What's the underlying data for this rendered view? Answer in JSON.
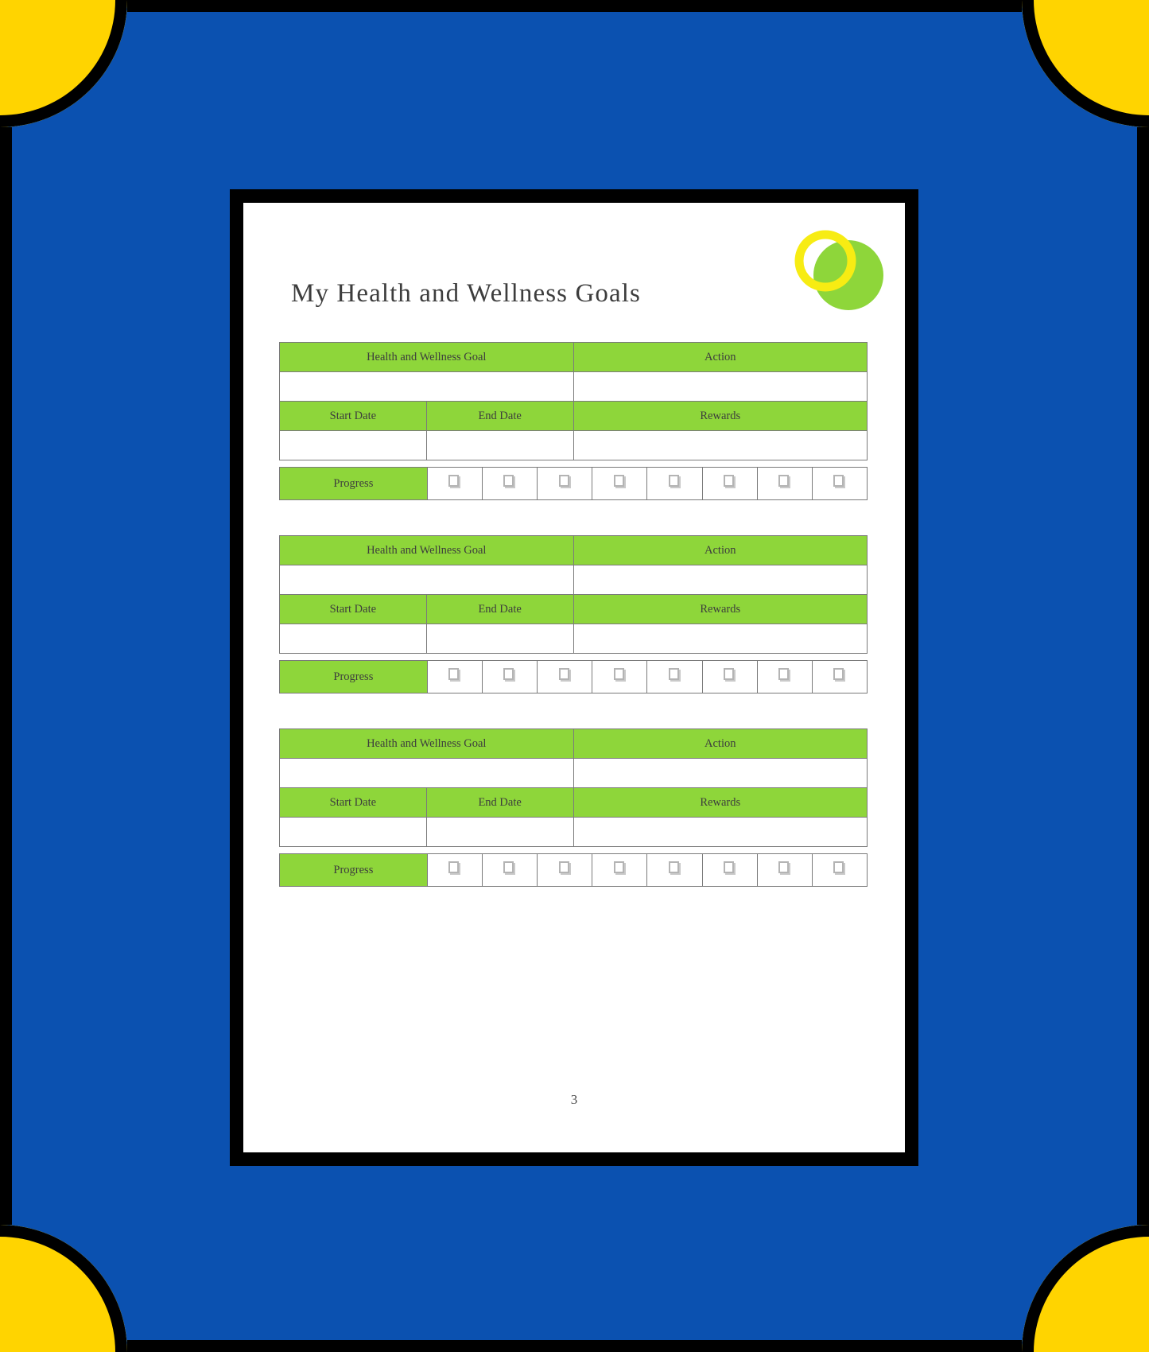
{
  "theme": {
    "background_blue": "#0b51b0",
    "corner_yellow": "#ffd400",
    "frame_black": "#000000",
    "table_green": "#8ed63a",
    "text_gray": "#3d3d3d",
    "logo_ring_yellow": "#f7ec13",
    "logo_circle_green": "#8ed63a"
  },
  "document": {
    "title": "My Health and Wellness Goals",
    "page_number": "3"
  },
  "logo": {
    "ring_name": "yellow-ring",
    "circle_name": "green-circle"
  },
  "table_headers": {
    "goal": "Health and Wellness Goal",
    "action": "Action",
    "start_date": "Start Date",
    "end_date": "End Date",
    "rewards": "Rewards",
    "progress": "Progress"
  },
  "goal_blocks": [
    {
      "index": 1,
      "goal_value": "",
      "action_value": "",
      "start_date_value": "",
      "end_date_value": "",
      "rewards_value": "",
      "progress_checkboxes": [
        {
          "checked": false
        },
        {
          "checked": false
        },
        {
          "checked": false
        },
        {
          "checked": false
        },
        {
          "checked": false
        },
        {
          "checked": false
        },
        {
          "checked": false
        },
        {
          "checked": false
        }
      ]
    },
    {
      "index": 2,
      "goal_value": "",
      "action_value": "",
      "start_date_value": "",
      "end_date_value": "",
      "rewards_value": "",
      "progress_checkboxes": [
        {
          "checked": false
        },
        {
          "checked": false
        },
        {
          "checked": false
        },
        {
          "checked": false
        },
        {
          "checked": false
        },
        {
          "checked": false
        },
        {
          "checked": false
        },
        {
          "checked": false
        }
      ]
    },
    {
      "index": 3,
      "goal_value": "",
      "action_value": "",
      "start_date_value": "",
      "end_date_value": "",
      "rewards_value": "",
      "progress_checkboxes": [
        {
          "checked": false
        },
        {
          "checked": false
        },
        {
          "checked": false
        },
        {
          "checked": false
        },
        {
          "checked": false
        },
        {
          "checked": false
        },
        {
          "checked": false
        },
        {
          "checked": false
        }
      ]
    }
  ]
}
